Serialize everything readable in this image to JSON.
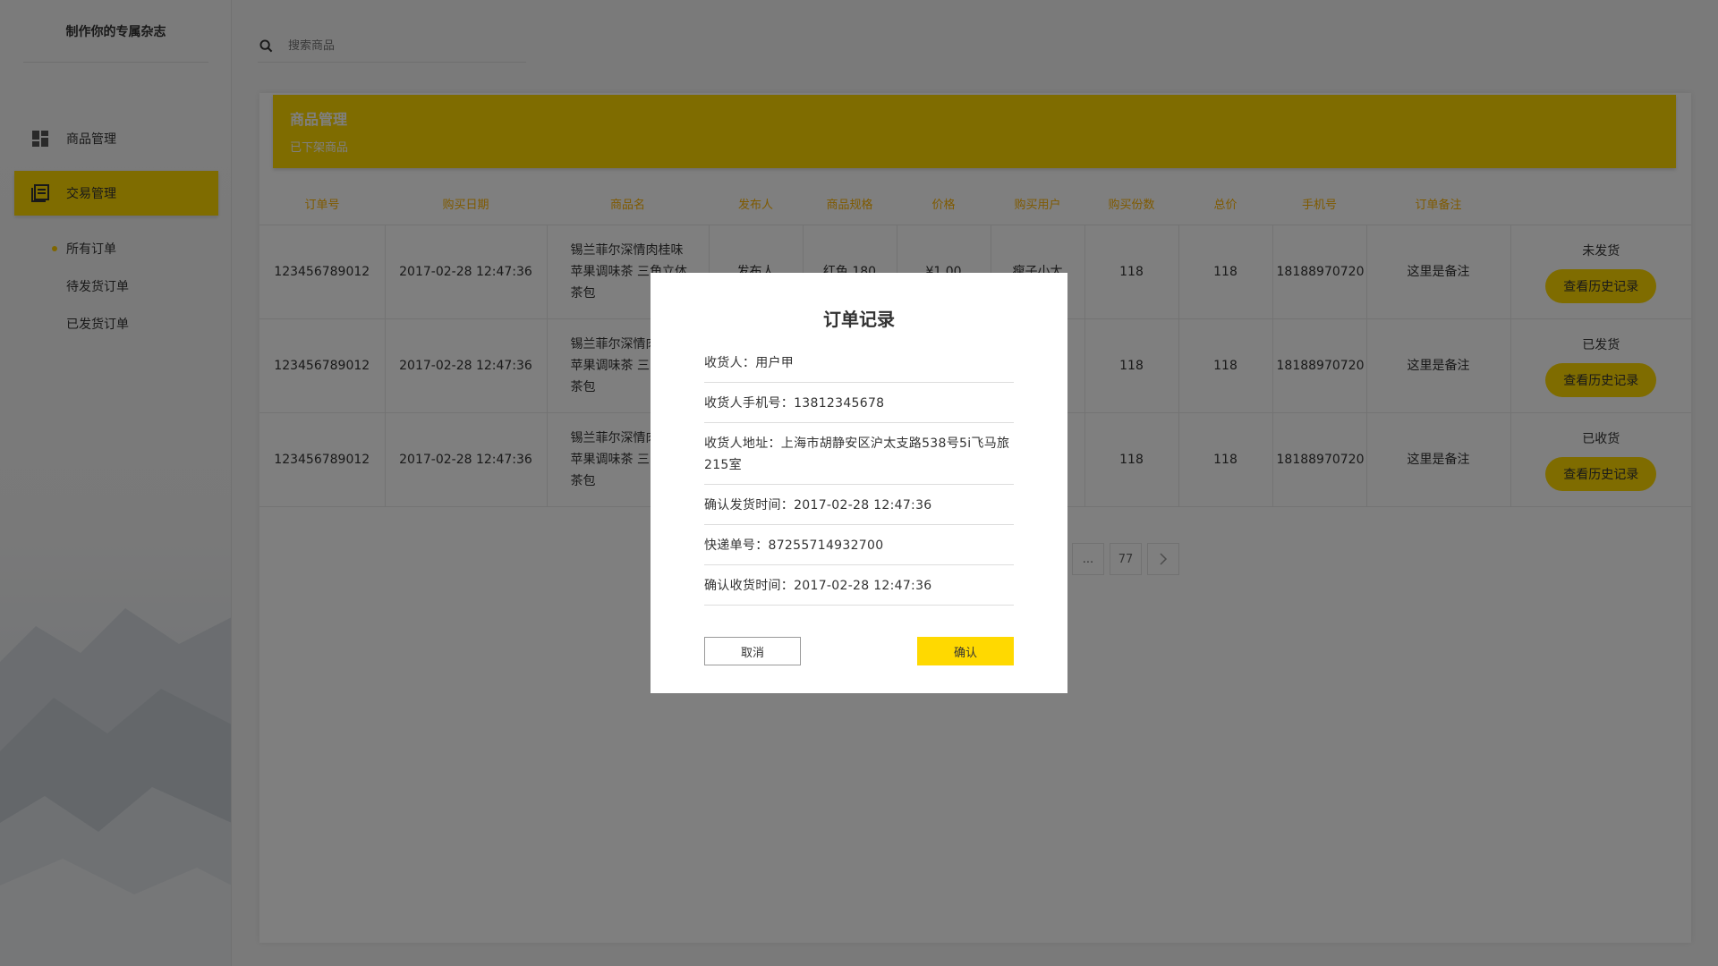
{
  "brand": {
    "title": "制作你的专属杂志"
  },
  "search": {
    "placeholder": "搜索商品"
  },
  "sidebar": {
    "items": [
      {
        "label": "商品管理",
        "icon": "dashboard-icon"
      },
      {
        "label": "交易管理",
        "icon": "book-icon",
        "active": true
      }
    ],
    "sub_items": [
      {
        "label": "所有订单",
        "active": true
      },
      {
        "label": "待发货订单"
      },
      {
        "label": "已发货订单"
      }
    ]
  },
  "banner": {
    "title": "商品管理",
    "subtitle": "已下架商品"
  },
  "table": {
    "headers": [
      "订单号",
      "购买日期",
      "商品名",
      "发布人",
      "商品规格",
      "价格",
      "购买用户",
      "购买份数",
      "总价",
      "手机号",
      "订单备注"
    ],
    "rows": [
      {
        "order_no": "123456789012",
        "date": "2017-02-28 12:47:36",
        "goods_line1": "锡兰菲尔深情肉桂味",
        "goods_line2": "苹果调味茶 三角立体",
        "goods_line3": "茶包",
        "publisher": "发布人",
        "spec": "红色 180",
        "price": "¥1.00",
        "buyer": "瘦子小太",
        "qty": "118",
        "total": "118",
        "phone": "18188970720",
        "note": "这里是备注",
        "status": "未发货",
        "action": "查看历史记录"
      },
      {
        "order_no": "123456789012",
        "date": "2017-02-28 12:47:36",
        "goods_line1": "锡兰菲尔深情肉",
        "goods_line2": "苹果调味茶 三",
        "goods_line3": "茶包",
        "publisher": "",
        "spec": "",
        "price": "",
        "buyer": "",
        "qty": "118",
        "total": "118",
        "phone": "18188970720",
        "note": "这里是备注",
        "status": "已发货",
        "action": "查看历史记录"
      },
      {
        "order_no": "123456789012",
        "date": "2017-02-28 12:47:36",
        "goods_line1": "锡兰菲尔深情肉",
        "goods_line2": "苹果调味茶 三",
        "goods_line3": "茶包",
        "publisher": "",
        "spec": "",
        "price": "",
        "buyer": "",
        "qty": "118",
        "total": "118",
        "phone": "18188970720",
        "note": "这里是备注",
        "status": "已收货",
        "action": "查看历史记录"
      }
    ]
  },
  "pagination": {
    "ellipsis": "...",
    "last_page": "77",
    "next_icon": "chevron-right-icon"
  },
  "modal": {
    "title": "订单记录",
    "rows": [
      "收货人：用户甲",
      "收货人手机号：13812345678",
      "收货人地址：上海市胡静安区沪太支路538号5i飞马旅215室",
      "确认发货时间：2017-02-28 12:47:36",
      "快递单号：87255714932700",
      "确认收货时间：2017-02-28 12:47:36"
    ],
    "cancel_label": "取消",
    "confirm_label": "确认"
  },
  "colors": {
    "accent": "#ffd900",
    "header_text": "#ffb400"
  }
}
